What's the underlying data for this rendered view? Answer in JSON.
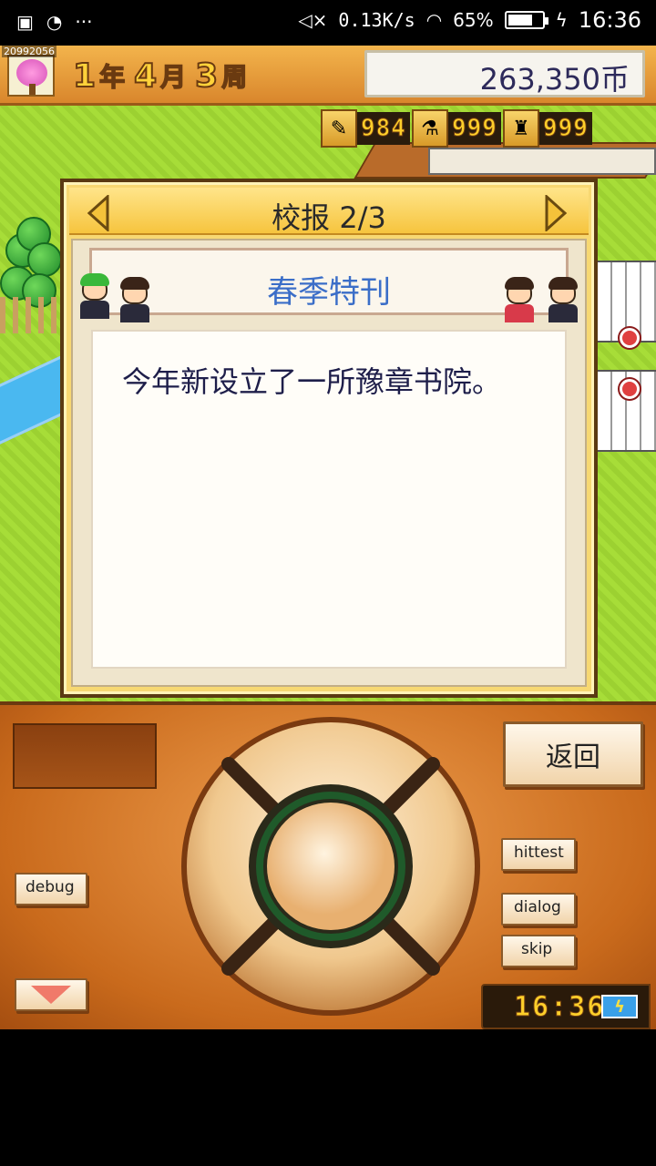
{
  "status_bar": {
    "network_speed": "0.13K/s",
    "battery_percent": "65%",
    "battery_level": 0.65,
    "time": "16:36"
  },
  "hud": {
    "campus_id": "20992056",
    "date": {
      "year": "1",
      "year_unit": "年",
      "month": "4",
      "month_unit": "月",
      "week": "3",
      "week_unit": "周"
    },
    "money": "263,350币"
  },
  "resources": [
    {
      "icon": "pencil-icon",
      "value": "984"
    },
    {
      "icon": "flask-icon",
      "value": "999"
    },
    {
      "icon": "trophy-icon",
      "value": "999"
    }
  ],
  "dialog": {
    "title": "校报 2/3",
    "headline": "春季特刊",
    "content": "今年新设立了一所豫章书院。"
  },
  "controls": {
    "back_label": "返回",
    "debug_label": "debug",
    "hittest_label": "hittest",
    "dialog_label": "dialog",
    "skip_label": "skip",
    "clock": "16:36"
  },
  "colors": {
    "hud_orange": "#e39a38",
    "dialog_gold": "#f7d872",
    "headline_blue": "#3b6ec8",
    "panel_orange": "#c96a1c",
    "grass_green": "#a7dd38"
  }
}
